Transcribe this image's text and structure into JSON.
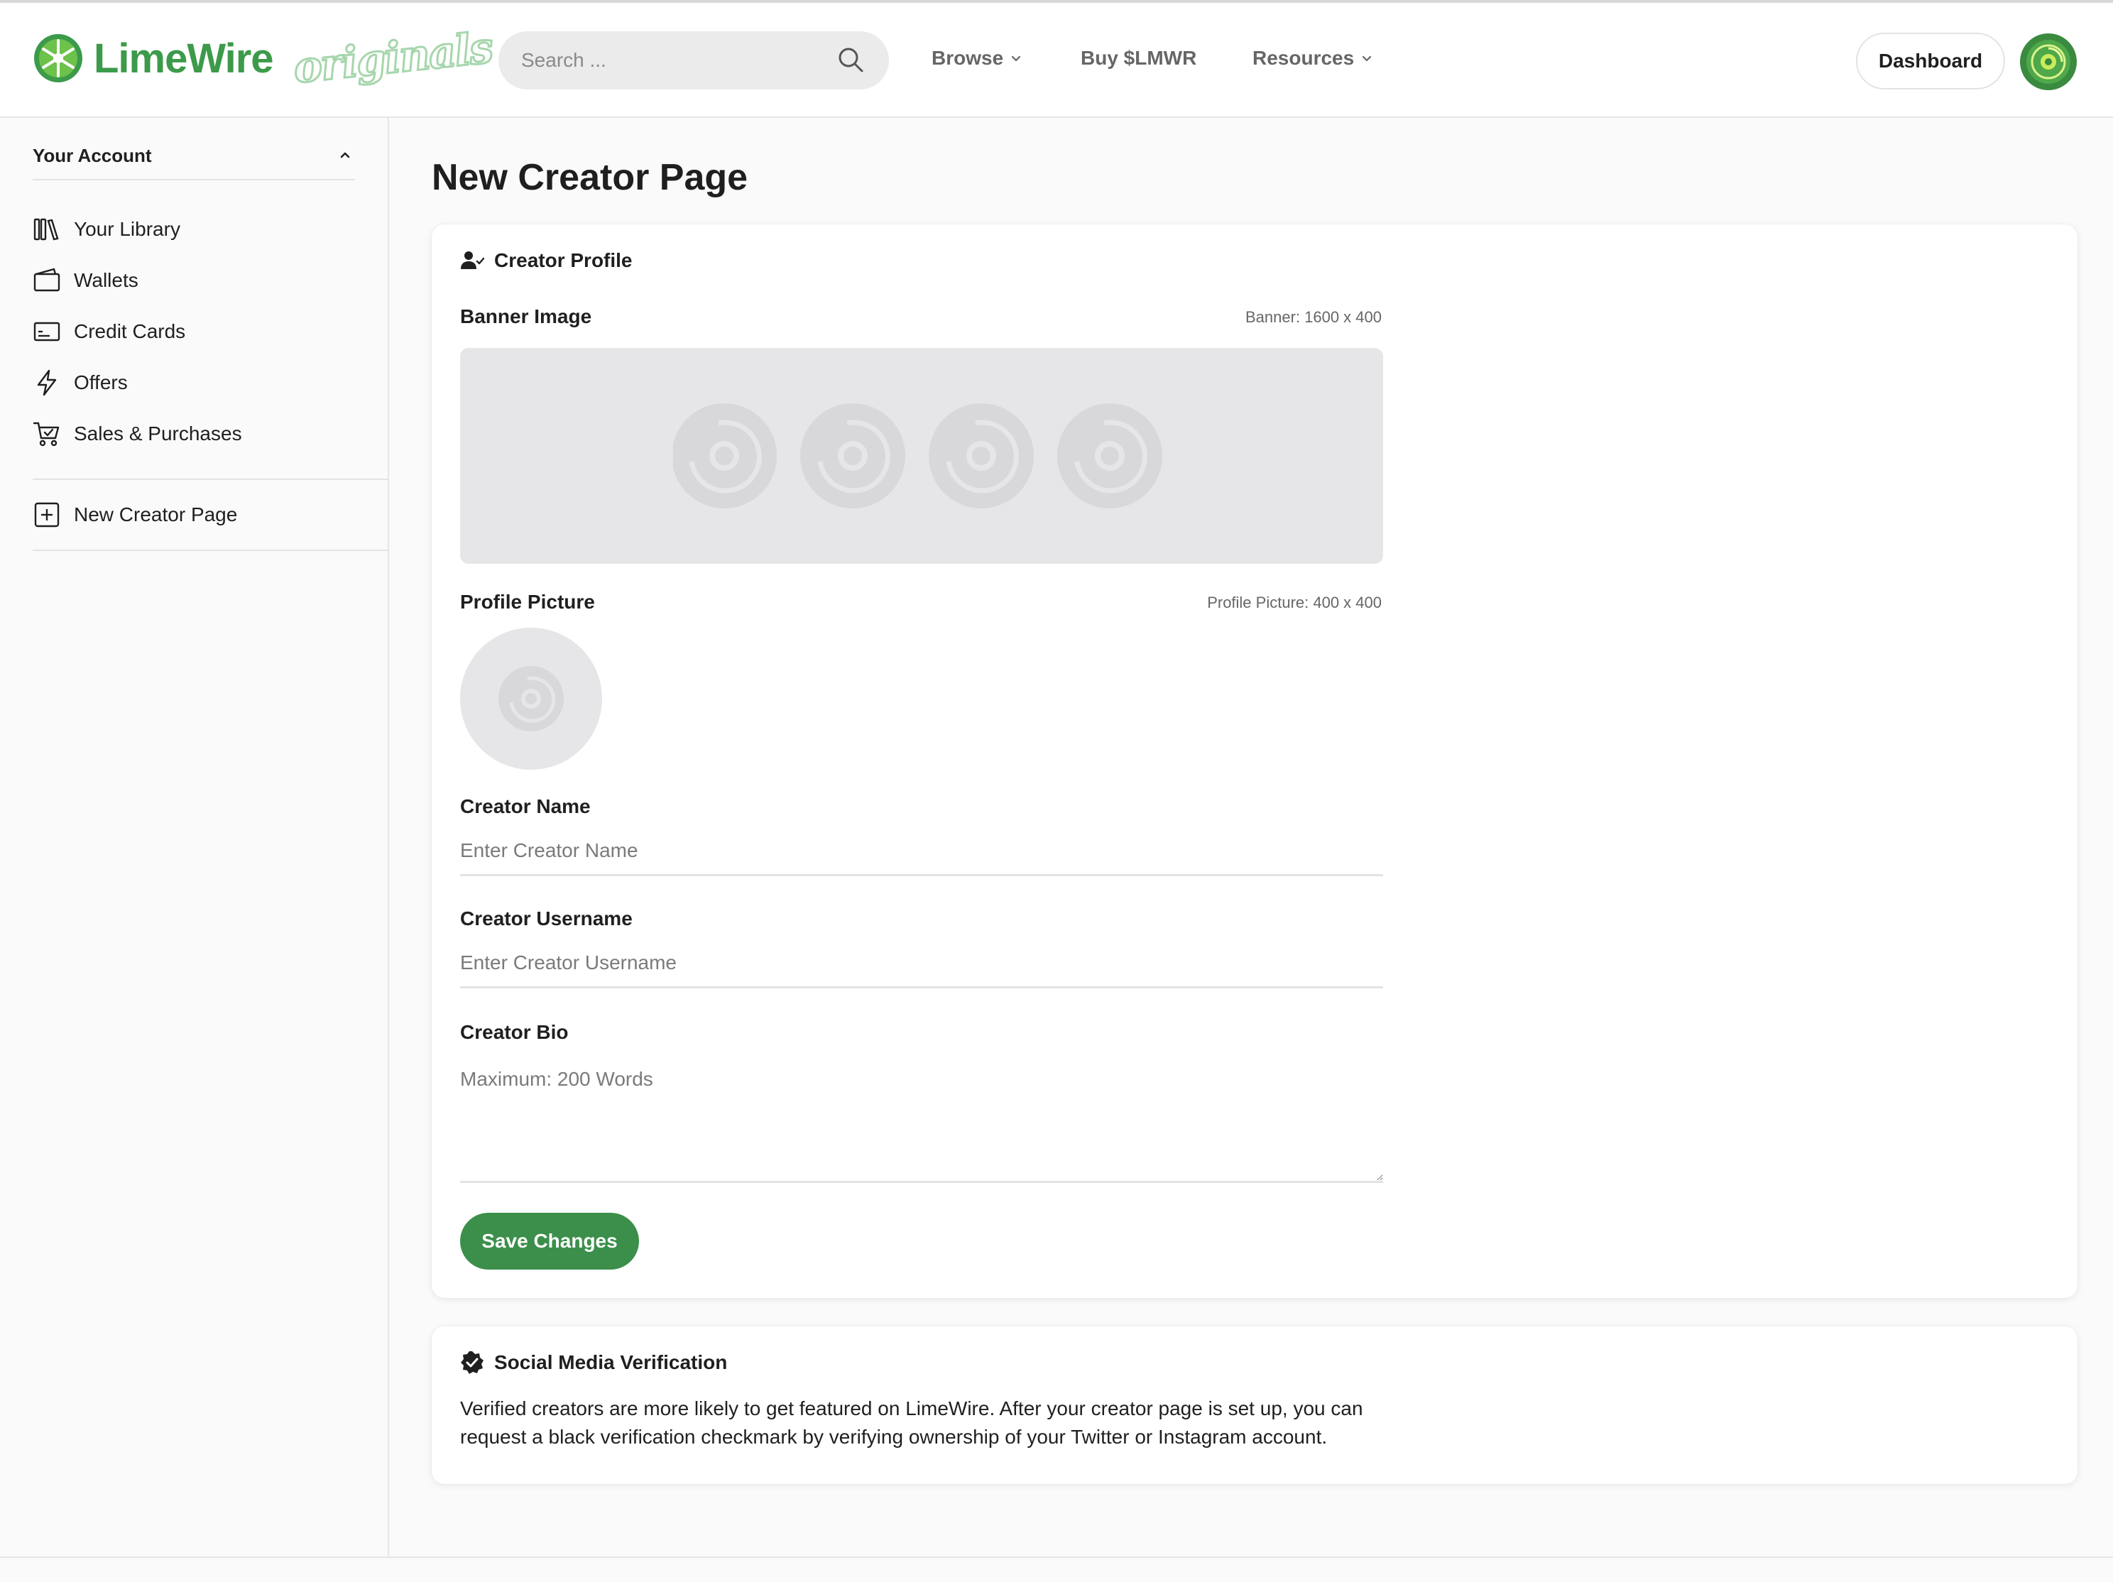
{
  "brand": {
    "name": "LimeWire",
    "tagline": "originals",
    "primary_color": "#3c9a4a",
    "button_color": "#3b8f4a"
  },
  "header": {
    "search": {
      "placeholder": "Search ...",
      "value": ""
    },
    "nav": [
      {
        "label": "Browse",
        "has_dropdown": true
      },
      {
        "label": "Buy $LMWR",
        "has_dropdown": false
      },
      {
        "label": "Resources",
        "has_dropdown": true
      }
    ],
    "dashboard_label": "Dashboard",
    "avatar_icon": "limewire-disc-avatar"
  },
  "sidebar": {
    "section_title": "Your Account",
    "items": [
      {
        "label": "Your Library",
        "icon": "library-icon"
      },
      {
        "label": "Wallets",
        "icon": "wallet-icon"
      },
      {
        "label": "Credit Cards",
        "icon": "credit-card-icon"
      },
      {
        "label": "Offers",
        "icon": "lightning-icon"
      },
      {
        "label": "Sales & Purchases",
        "icon": "cart-icon"
      }
    ],
    "new_creator": {
      "label": "New Creator Page",
      "icon": "plus-square-icon"
    }
  },
  "main": {
    "title": "New Creator Page",
    "profile_card": {
      "heading": "Creator Profile",
      "banner_label": "Banner Image",
      "banner_hint": "Banner: 1600 x 400",
      "profile_label": "Profile Picture",
      "profile_hint": "Profile Picture: 400 x 400",
      "name_label": "Creator Name",
      "name_placeholder": "Enter Creator Name",
      "username_label": "Creator Username",
      "username_placeholder": "Enter Creator Username",
      "bio_label": "Creator Bio",
      "bio_placeholder": "Maximum: 200 Words",
      "save_label": "Save Changes"
    },
    "verification_card": {
      "heading": "Social Media Verification",
      "text": "Verified creators are more likely to get featured on LimeWire. After your creator page is set up, you can request a black verification checkmark by verifying ownership of your Twitter or Instagram account."
    }
  }
}
